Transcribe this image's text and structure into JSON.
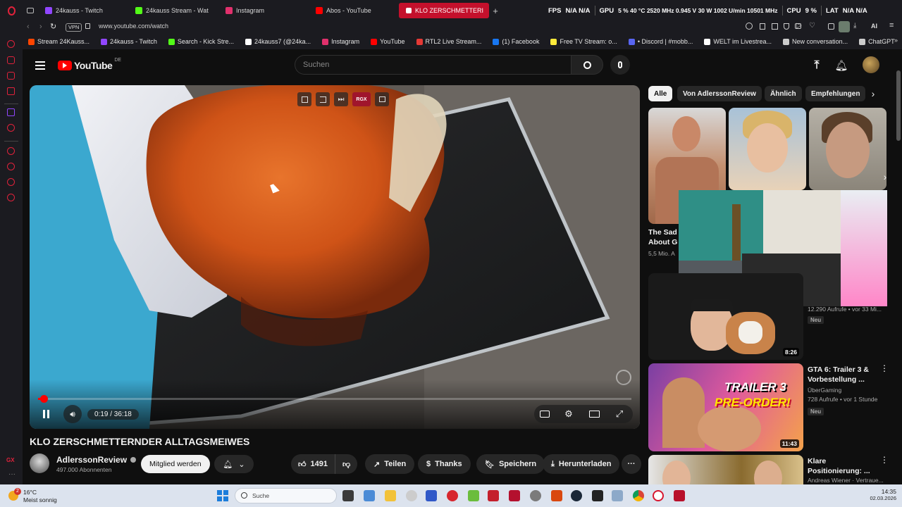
{
  "browser": {
    "tabs": [
      {
        "label": "24kauss - Twitch",
        "color": "#9146ff"
      },
      {
        "label": "24kauss Stream - Wat",
        "color": "#53fc18"
      },
      {
        "label": "Instagram",
        "color": "#e1306c"
      },
      {
        "label": "Abos - YouTube",
        "color": "#ff0000"
      },
      {
        "label": "KLO ZERSCHMETTERI",
        "color": "#ffffff"
      }
    ],
    "hw_monitor": {
      "fps_label": "FPS",
      "fps_value": "N/A N/A",
      "gpu_label": "GPU",
      "gpu_value": "5 % 40 °C 2520 MHz 0.945 V 30 W 1002 U/min 10501 MHz",
      "cpu_label": "CPU",
      "cpu_value": "9 %",
      "lat_label": "LAT",
      "lat_value": "N/A N/A"
    },
    "vpn_label": "VPN",
    "url": "www.youtube.com/watch",
    "toolbar_ai": "AI",
    "bookmarks": [
      {
        "label": "Stream 24Kauss...",
        "color": "#ff4500"
      },
      {
        "label": "24kauss - Twitch",
        "color": "#9146ff"
      },
      {
        "label": "Search - Kick Stre...",
        "color": "#53fc18"
      },
      {
        "label": "24kauss7 (@24ka...",
        "color": "#ffffff"
      },
      {
        "label": "Instagram",
        "color": "#e1306c"
      },
      {
        "label": "YouTube",
        "color": "#ff0000"
      },
      {
        "label": "RTL2 Live Stream...",
        "color": "#e53935"
      },
      {
        "label": "(1) Facebook",
        "color": "#1877f2"
      },
      {
        "label": "Free TV Stream: o...",
        "color": "#ffeb3b"
      },
      {
        "label": "• Discord | #mobb...",
        "color": "#5865f2"
      },
      {
        "label": "WELT im Livestrea...",
        "color": "#ffffff"
      },
      {
        "label": "New conversation...",
        "color": "#cccccc"
      },
      {
        "label": "ChatGPT",
        "color": "#cccccc"
      }
    ]
  },
  "youtube": {
    "logo_text": "YouTube",
    "logo_region": "DE",
    "search_placeholder": "Suchen",
    "video": {
      "time": "0:19 / 36:18",
      "progress_fraction": 0.009,
      "overlay_rgx": "RGX",
      "title": "KLO ZERSCHMETTERNDER ALLTAGSMEIWES"
    },
    "channel": {
      "name": "AdlerssonReview",
      "subs": "497.000 Abonnenten",
      "join_label": "Mitglied werden"
    },
    "actions": {
      "likes": "1491",
      "share": "Teilen",
      "thanks": "Thanks",
      "save": "Speichern",
      "download": "Herunterladen"
    },
    "chips": [
      "Alle",
      "Von AdlerssonReview",
      "Ähnlich",
      "Empfehlungen"
    ],
    "recommendations": [
      {
        "title": "The Sad",
        "title2": "About G",
        "meta": "5,5 Mio. A"
      },
      {
        "meta": "12.290 Aufrufe • vor 33 Mi...",
        "badge": "Neu",
        "duration": "8:26"
      },
      {
        "title": "GTA 6: Trailer 3 &",
        "title2": "Vorbestellung ...",
        "channel": "ÜberGaming",
        "meta": "728 Aufrufe • vor 1 Stunde",
        "badge": "Neu",
        "duration": "11:43",
        "thumb_text1": "TRAILER 3",
        "thumb_text2": "PRE-ORDER!"
      },
      {
        "title": "Klare",
        "title2": "Positionierung: ...",
        "channel": "Andreas Wiener · Vertraue..."
      }
    ]
  },
  "taskbar": {
    "weather_temp": "16°C",
    "weather_desc": "Meist sonnig",
    "weather_badge": "2",
    "search_label": "Suche",
    "time": "14:35",
    "date": "02.03.2026"
  },
  "colors": {
    "yt_bg": "#0f0f0f",
    "yt_red": "#ff0000",
    "opera_red": "#c4102c",
    "chip_bg": "#272727"
  }
}
